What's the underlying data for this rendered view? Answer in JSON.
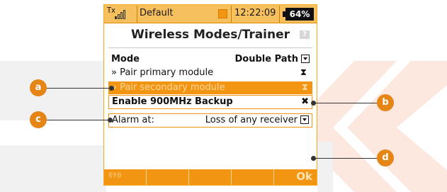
{
  "status_bar": {
    "tx_label": "Tx",
    "model_name": "Default",
    "time": "12:22:09",
    "battery_percent": "64%",
    "signal_bars_lit": 1,
    "signal_bars_total": 4
  },
  "screen": {
    "title": "Wireless Modes/Trainer",
    "help_icon": "help-icon"
  },
  "rows": {
    "mode_label": "Mode",
    "mode_value": "Double Path",
    "pair_primary_label": "» Pair primary module",
    "pair_primary_icon": "hourglass-icon",
    "pair_secondary_label": "» Pair secondary module",
    "pair_secondary_icon": "hourglass-icon",
    "backup_label": "Enable 900MHz Backup",
    "backup_value": "✖",
    "alarm_label": "Alarm at:",
    "alarm_value": "Loss of any receiver"
  },
  "softkeys": {
    "f1_icon": "wireless-trainer-icon",
    "f5_label": "Ok"
  },
  "callouts": {
    "a": "a",
    "b": "b",
    "c": "c",
    "d": "d"
  },
  "colors": {
    "accent": "#f29512",
    "status_bar": "#f7c05f",
    "callout": "#e48516",
    "watermark": "#f1f1f1",
    "watermark_accent": "#fde8df"
  }
}
